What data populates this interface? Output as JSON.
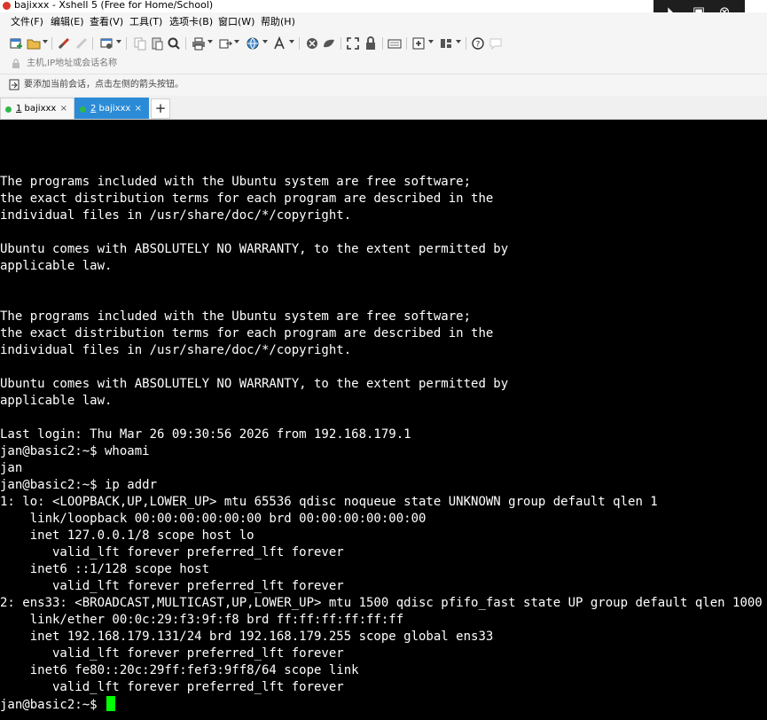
{
  "window": {
    "title": "bajixxx - Xshell 5 (Free for Home/School)"
  },
  "menu": [
    "文件(F)",
    "编辑(E)",
    "查看(V)",
    "工具(T)",
    "选项卡(B)",
    "窗口(W)",
    "帮助(H)"
  ],
  "address_bar": {
    "placeholder": "主机,IP地址或会话名称"
  },
  "hint_bar": {
    "text": "要添加当前会话，点击左侧的箭头按钮。"
  },
  "tabs": [
    {
      "index": "1",
      "name": " bajixxx",
      "active": false,
      "close": "×"
    },
    {
      "index": "2",
      "name": " bajixxx",
      "active": true,
      "close": "×"
    }
  ],
  "add_tab_label": "+",
  "overlay_buttons": [
    {
      "icon": "cast-icon",
      "glyph": "◣"
    },
    {
      "icon": "fit-screen-icon",
      "glyph": "▣"
    },
    {
      "icon": "close-icon",
      "glyph": "⊗"
    }
  ],
  "terminal": {
    "lines": [
      "The programs included with the Ubuntu system are free software;",
      "the exact distribution terms for each program are described in the",
      "individual files in /usr/share/doc/*/copyright.",
      "",
      "Ubuntu comes with ABSOLUTELY NO WARRANTY, to the extent permitted by",
      "applicable law.",
      "",
      "",
      "The programs included with the Ubuntu system are free software;",
      "the exact distribution terms for each program are described in the",
      "individual files in /usr/share/doc/*/copyright.",
      "",
      "Ubuntu comes with ABSOLUTELY NO WARRANTY, to the extent permitted by",
      "applicable law.",
      "",
      "Last login: Thu Mar 26 09:30:56 2026 from 192.168.179.1",
      "jan@basic2:~$ whoami",
      "jan",
      "jan@basic2:~$ ip addr",
      "1: lo: <LOOPBACK,UP,LOWER_UP> mtu 65536 qdisc noqueue state UNKNOWN group default qlen 1",
      "    link/loopback 00:00:00:00:00:00 brd 00:00:00:00:00:00",
      "    inet 127.0.0.1/8 scope host lo",
      "       valid_lft forever preferred_lft forever",
      "    inet6 ::1/128 scope host",
      "       valid_lft forever preferred_lft forever",
      "2: ens33: <BROADCAST,MULTICAST,UP,LOWER_UP> mtu 1500 qdisc pfifo_fast state UP group default qlen 1000",
      "    link/ether 00:0c:29:f3:9f:f8 brd ff:ff:ff:ff:ff:ff",
      "    inet 192.168.179.131/24 brd 192.168.179.255 scope global ens33",
      "       valid_lft forever preferred_lft forever",
      "    inet6 fe80::20c:29ff:fef3:9ff8/64 scope link",
      "       valid_lft forever preferred_lft forever"
    ],
    "prompt": "jan@basic2:~$ ",
    "cursor_color": "#00ff00"
  },
  "colors": {
    "terminal_bg": "#000000",
    "terminal_fg": "#ffffff",
    "active_tab": "#2b8bd6",
    "session_dot": "#2fb84b"
  }
}
